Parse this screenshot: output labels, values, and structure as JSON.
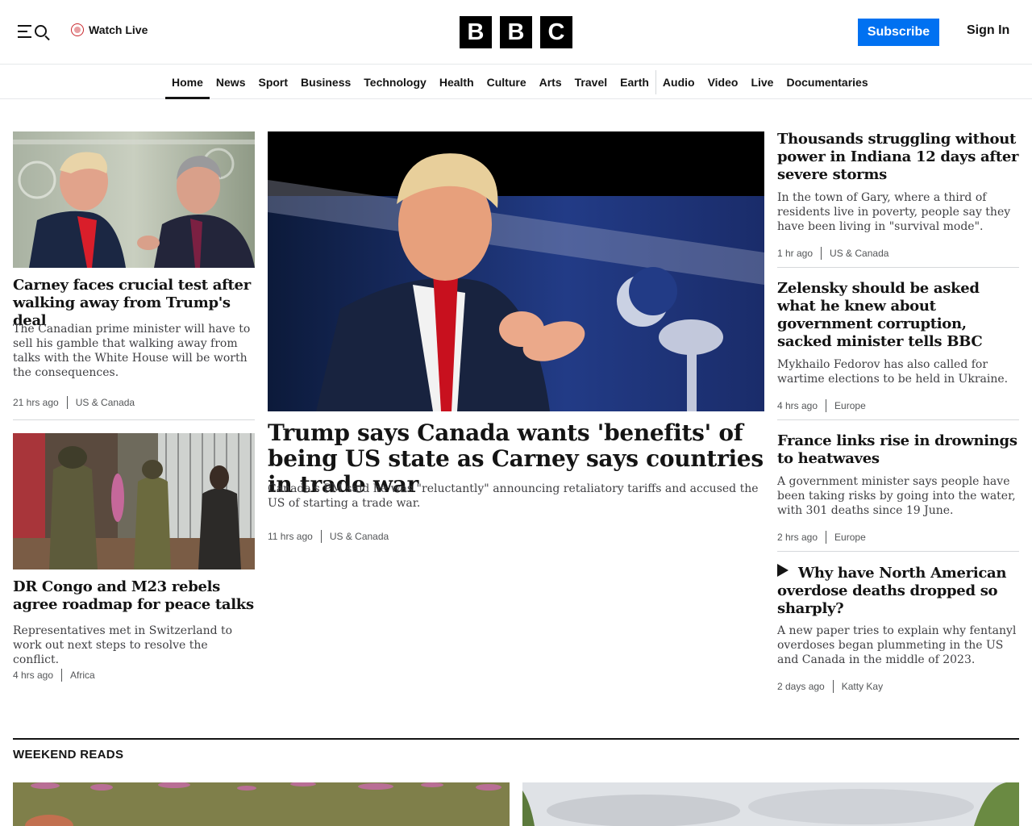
{
  "header": {
    "watch_live": "Watch Live",
    "logo_letters": [
      "B",
      "B",
      "C"
    ],
    "subscribe": "Subscribe",
    "sign_in": "Sign In"
  },
  "nav": {
    "items": [
      "Home",
      "News",
      "Sport",
      "Business",
      "Technology",
      "Health",
      "Culture",
      "Arts",
      "Travel",
      "Earth",
      "Audio",
      "Video",
      "Live",
      "Documentaries"
    ],
    "active": "Home"
  },
  "left_stories": [
    {
      "headline": "Carney faces crucial test after walking away from Trump's deal",
      "summary": "The Canadian prime minister will have to sell his gamble that walking away from talks with the White House will be worth the consequences.",
      "time": "21 hrs ago",
      "section": "US & Canada"
    },
    {
      "headline": "DR Congo and M23 rebels agree roadmap for peace talks",
      "summary": "Representatives met in Switzerland to work out next steps to resolve the conflict.",
      "time": "4 hrs ago",
      "section": "Africa"
    }
  ],
  "main_story": {
    "headline": "Trump says Canada wants 'benefits' of being US state as Carney says countries in trade war",
    "summary": "Canada's PM said he was \"reluctantly\" announcing retaliatory tariffs and accused the US of starting a trade war.",
    "time": "11 hrs ago",
    "section": "US & Canada"
  },
  "right_stories": [
    {
      "headline": "Thousands struggling without power in Indiana 12 days after severe storms",
      "summary": "In the town of Gary, where a third of residents live in poverty, people say they have been living in \"survival mode\".",
      "time": "1 hr ago",
      "section": "US & Canada"
    },
    {
      "headline": "Zelensky should be asked what he knew about government corruption, sacked minister tells BBC",
      "summary": "Mykhailo Fedorov has also called for wartime elections to be held in Ukraine.",
      "time": "4 hrs ago",
      "section": "Europe"
    },
    {
      "headline": "France links rise in drownings to heatwaves",
      "summary": "A government minister says people have been taking risks by going into the water, with 301 deaths since 19 June.",
      "time": "2 hrs ago",
      "section": "Europe"
    },
    {
      "headline": "Why have North American overdose deaths dropped so sharply?",
      "summary": "A new paper tries to explain why fentanyl overdoses began plummeting in the US and Canada in the middle of 2023.",
      "time": "2 days ago",
      "section": "Katty Kay",
      "icon": "play-icon"
    }
  ],
  "weekend_reads": {
    "title": "WEEKEND READS"
  },
  "colors": {
    "accent": "#0071f1",
    "live": "#c9282d",
    "text": "#141414"
  }
}
